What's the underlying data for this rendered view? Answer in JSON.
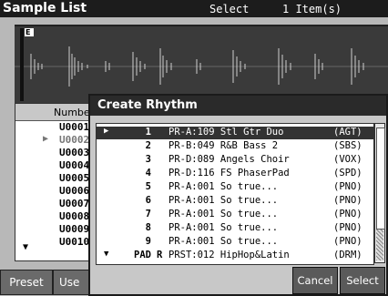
{
  "header": {
    "title": "Sample List",
    "select_label": "Select",
    "select_count": "1 Item(s)"
  },
  "waveform": {
    "marker_label": "E"
  },
  "sample_list": {
    "column_header": "Numbe",
    "items": [
      "U0001",
      "U0002",
      "U0003",
      "U0004",
      "U0005",
      "U0006",
      "U0007",
      "U0008",
      "U0009",
      "U0010"
    ]
  },
  "tabs": {
    "preset": "Preset",
    "user": "Use"
  },
  "dialog": {
    "title": "Create Rhythm",
    "rows": [
      {
        "num": "1",
        "flag": "",
        "patch": "PR-A:109 Stl Gtr Duo",
        "cat": "(AGT)"
      },
      {
        "num": "2",
        "flag": "",
        "patch": "PR-B:049 R&B Bass 2",
        "cat": "(SBS)"
      },
      {
        "num": "3",
        "flag": "",
        "patch": "PR-D:089 Angels Choir",
        "cat": "(VOX)"
      },
      {
        "num": "4",
        "flag": "",
        "patch": "PR-D:116 FS PhaserPad",
        "cat": "(SPD)"
      },
      {
        "num": "5",
        "flag": "",
        "patch": "PR-A:001 So true...",
        "cat": "(PNO)"
      },
      {
        "num": "6",
        "flag": "",
        "patch": "PR-A:001 So true...",
        "cat": "(PNO)"
      },
      {
        "num": "7",
        "flag": "",
        "patch": "PR-A:001 So true...",
        "cat": "(PNO)"
      },
      {
        "num": "8",
        "flag": "",
        "patch": "PR-A:001 So true...",
        "cat": "(PNO)"
      },
      {
        "num": "9",
        "flag": "",
        "patch": "PR-A:001 So true...",
        "cat": "(PNO)"
      },
      {
        "num": "PAD",
        "flag": "R",
        "patch": "PRST:012 HipHop&Latin",
        "cat": "(DRM)"
      }
    ],
    "cancel_label": "Cancel",
    "select_label": "Select"
  },
  "colors": {
    "title_bar": "#1c1c1c",
    "selected_row": "#333333",
    "button": "#5a5a5a"
  }
}
